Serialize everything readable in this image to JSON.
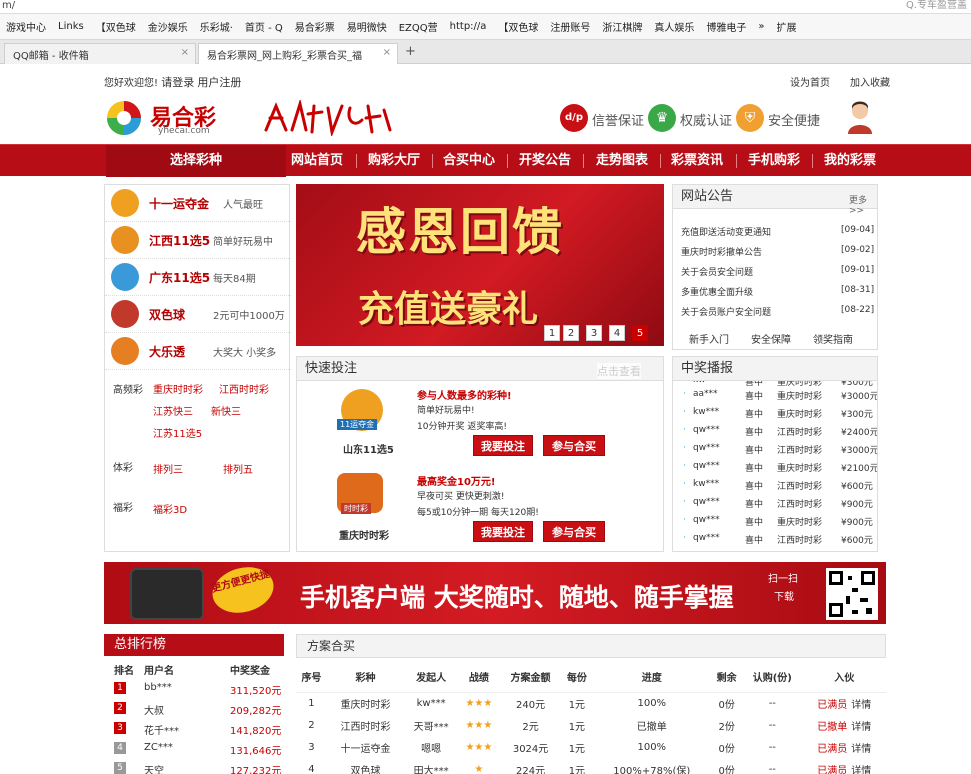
{
  "browser": {
    "address": "m/",
    "right_text": "Q.专车盈营盖",
    "bookmarks": [
      "游戏中心",
      "Links",
      "【双色球",
      "金沙娱乐",
      "乐彩城·",
      "首页 - Q",
      "易合彩票",
      "易明微快",
      "EZQQ营",
      "http://a",
      "【双色球",
      "注册账号",
      "浙江棋牌",
      "真人娱乐",
      "博雅电子",
      "»",
      "扩展"
    ],
    "tabs": [
      {
        "label": "QQ邮箱 - 收件箱"
      },
      {
        "label": "易合彩票网_网上购彩_彩票合买_福"
      }
    ],
    "new_tab": "+"
  },
  "top": {
    "welcome": "您好欢迎您!",
    "login": "请登录",
    "register": "用户注册",
    "set_home": "设为首页",
    "add_fav": "加入收藏"
  },
  "logo": {
    "name": "易合彩",
    "domain": "yhecai.com",
    "badge_credit": "信誉保证",
    "badge_auth": "权威认证",
    "badge_safe": "安全便捷"
  },
  "nav": {
    "select": "选择彩种",
    "items": [
      "网站首页",
      "购彩大厅",
      "合买中心",
      "开奖公告",
      "走势图表",
      "彩票资讯",
      "手机购彩",
      "我的彩票"
    ]
  },
  "lotteries": [
    {
      "name": "十一运夺金",
      "desc": "人气最旺",
      "color": "#f0a020"
    },
    {
      "name": "江西11选5",
      "desc": "简单好玩易中",
      "color": "#e89020"
    },
    {
      "name": "广东11选5",
      "desc": "每天84期",
      "color": "#3a9ad9"
    },
    {
      "name": "双色球",
      "desc": "2元可中1000万",
      "color": "#c0392b"
    },
    {
      "name": "大乐透",
      "desc": "大奖大 小奖多",
      "color": "#e67e22"
    }
  ],
  "categories": [
    {
      "label": "高频彩",
      "items": [
        "重庆时时彩",
        "江西时时彩",
        "江苏快三",
        "新快三",
        "江苏11选5"
      ]
    },
    {
      "label": "体彩",
      "items": [
        "排列三",
        "排列五"
      ]
    },
    {
      "label": "福彩",
      "items": [
        "福彩3D"
      ]
    }
  ],
  "banner": {
    "line1": "感恩回馈",
    "line2": "充值送豪礼",
    "pages": [
      "1",
      "2",
      "3",
      "4",
      "5"
    ],
    "watermark": "点击查看"
  },
  "notice": {
    "title": "网站公告",
    "more": "更多>>",
    "items": [
      {
        "t": "充值即送活动变更通知",
        "d": "[09-04]"
      },
      {
        "t": "重庆时时彩撤单公告",
        "d": "[09-02]"
      },
      {
        "t": "关于会员安全问题",
        "d": "[09-01]"
      },
      {
        "t": "多重优惠全面升级",
        "d": "[08-31]"
      },
      {
        "t": "关于会员账户安全问题",
        "d": "[08-22]"
      }
    ],
    "links": [
      "新手入门",
      "安全保障",
      "领奖指南"
    ]
  },
  "quick": {
    "title": "快速投注",
    "items": [
      {
        "name": "山东11选5",
        "head": "参与人数最多的彩种!",
        "l1": "简单好玩易中!",
        "l2": "10分钟开奖 返奖率高!",
        "logo": "11运夺金"
      },
      {
        "name": "重庆时时彩",
        "head": "最高奖金10万元!",
        "l1": "早夜可买 更快更刺激!",
        "l2": "每5或10分钟一期 每天120期!",
        "logo": "时时彩"
      }
    ],
    "bet": "我要投注",
    "join": "参与合买"
  },
  "winners": {
    "title": "中奖播报",
    "rows": [
      [
        "aa***",
        "喜中",
        "重庆时时彩",
        "¥3000元"
      ],
      [
        "kw***",
        "喜中",
        "重庆时时彩",
        "¥300元"
      ],
      [
        "qw***",
        "喜中",
        "江西时时彩",
        "¥2400元"
      ],
      [
        "qw***",
        "喜中",
        "江西时时彩",
        "¥3000元"
      ],
      [
        "qw***",
        "喜中",
        "重庆时时彩",
        "¥2100元"
      ],
      [
        "kw***",
        "喜中",
        "江西时时彩",
        "¥600元"
      ],
      [
        "qw***",
        "喜中",
        "江西时时彩",
        "¥900元"
      ],
      [
        "qw***",
        "喜中",
        "重庆时时彩",
        "¥900元"
      ],
      [
        "qw***",
        "喜中",
        "江西时时彩",
        "¥600元"
      ]
    ],
    "top_partial": [
      "kw",
      "喜中",
      "重庆时时彩",
      "¥300元"
    ]
  },
  "ad": {
    "badge": "更方便更快捷",
    "text": "手机客户端 大奖随时、随地、随手掌握",
    "scan": "扫一扫",
    "download": "下载"
  },
  "ranking": {
    "title": "总排行榜",
    "cols": [
      "排名",
      "用户名",
      "中奖奖金"
    ],
    "rows": [
      [
        "1",
        "bb***",
        "311,520元"
      ],
      [
        "2",
        "大叔",
        "209,282元"
      ],
      [
        "3",
        "花千***",
        "141,820元"
      ],
      [
        "4",
        "ZC***",
        "131,646元"
      ],
      [
        "5",
        "天空",
        "127,232元"
      ]
    ]
  },
  "plans": {
    "title": "方案合买",
    "cols": [
      "序号",
      "彩种",
      "发起人",
      "战绩",
      "方案金额",
      "每份",
      "进度",
      "剩余",
      "认购(份)",
      "入伙"
    ],
    "rows": [
      [
        "1",
        "重庆时时彩",
        "kw***",
        "★★★",
        "240元",
        "1元",
        "100%",
        "0份",
        "--",
        "已满员",
        "详情"
      ],
      [
        "2",
        "江西时时彩",
        "天哥***",
        "★★★",
        "2元",
        "1元",
        "已撤单",
        "2份",
        "--",
        "已撤单",
        "详情"
      ],
      [
        "3",
        "十一运夺金",
        "嗯嗯",
        "★★★",
        "3024元",
        "1元",
        "100%",
        "0份",
        "--",
        "已满员",
        "详情"
      ],
      [
        "4",
        "双色球",
        "田大***",
        "★",
        "224元",
        "1元",
        "100%+78%(保)",
        "0份",
        "--",
        "已满员",
        "详情"
      ]
    ]
  }
}
